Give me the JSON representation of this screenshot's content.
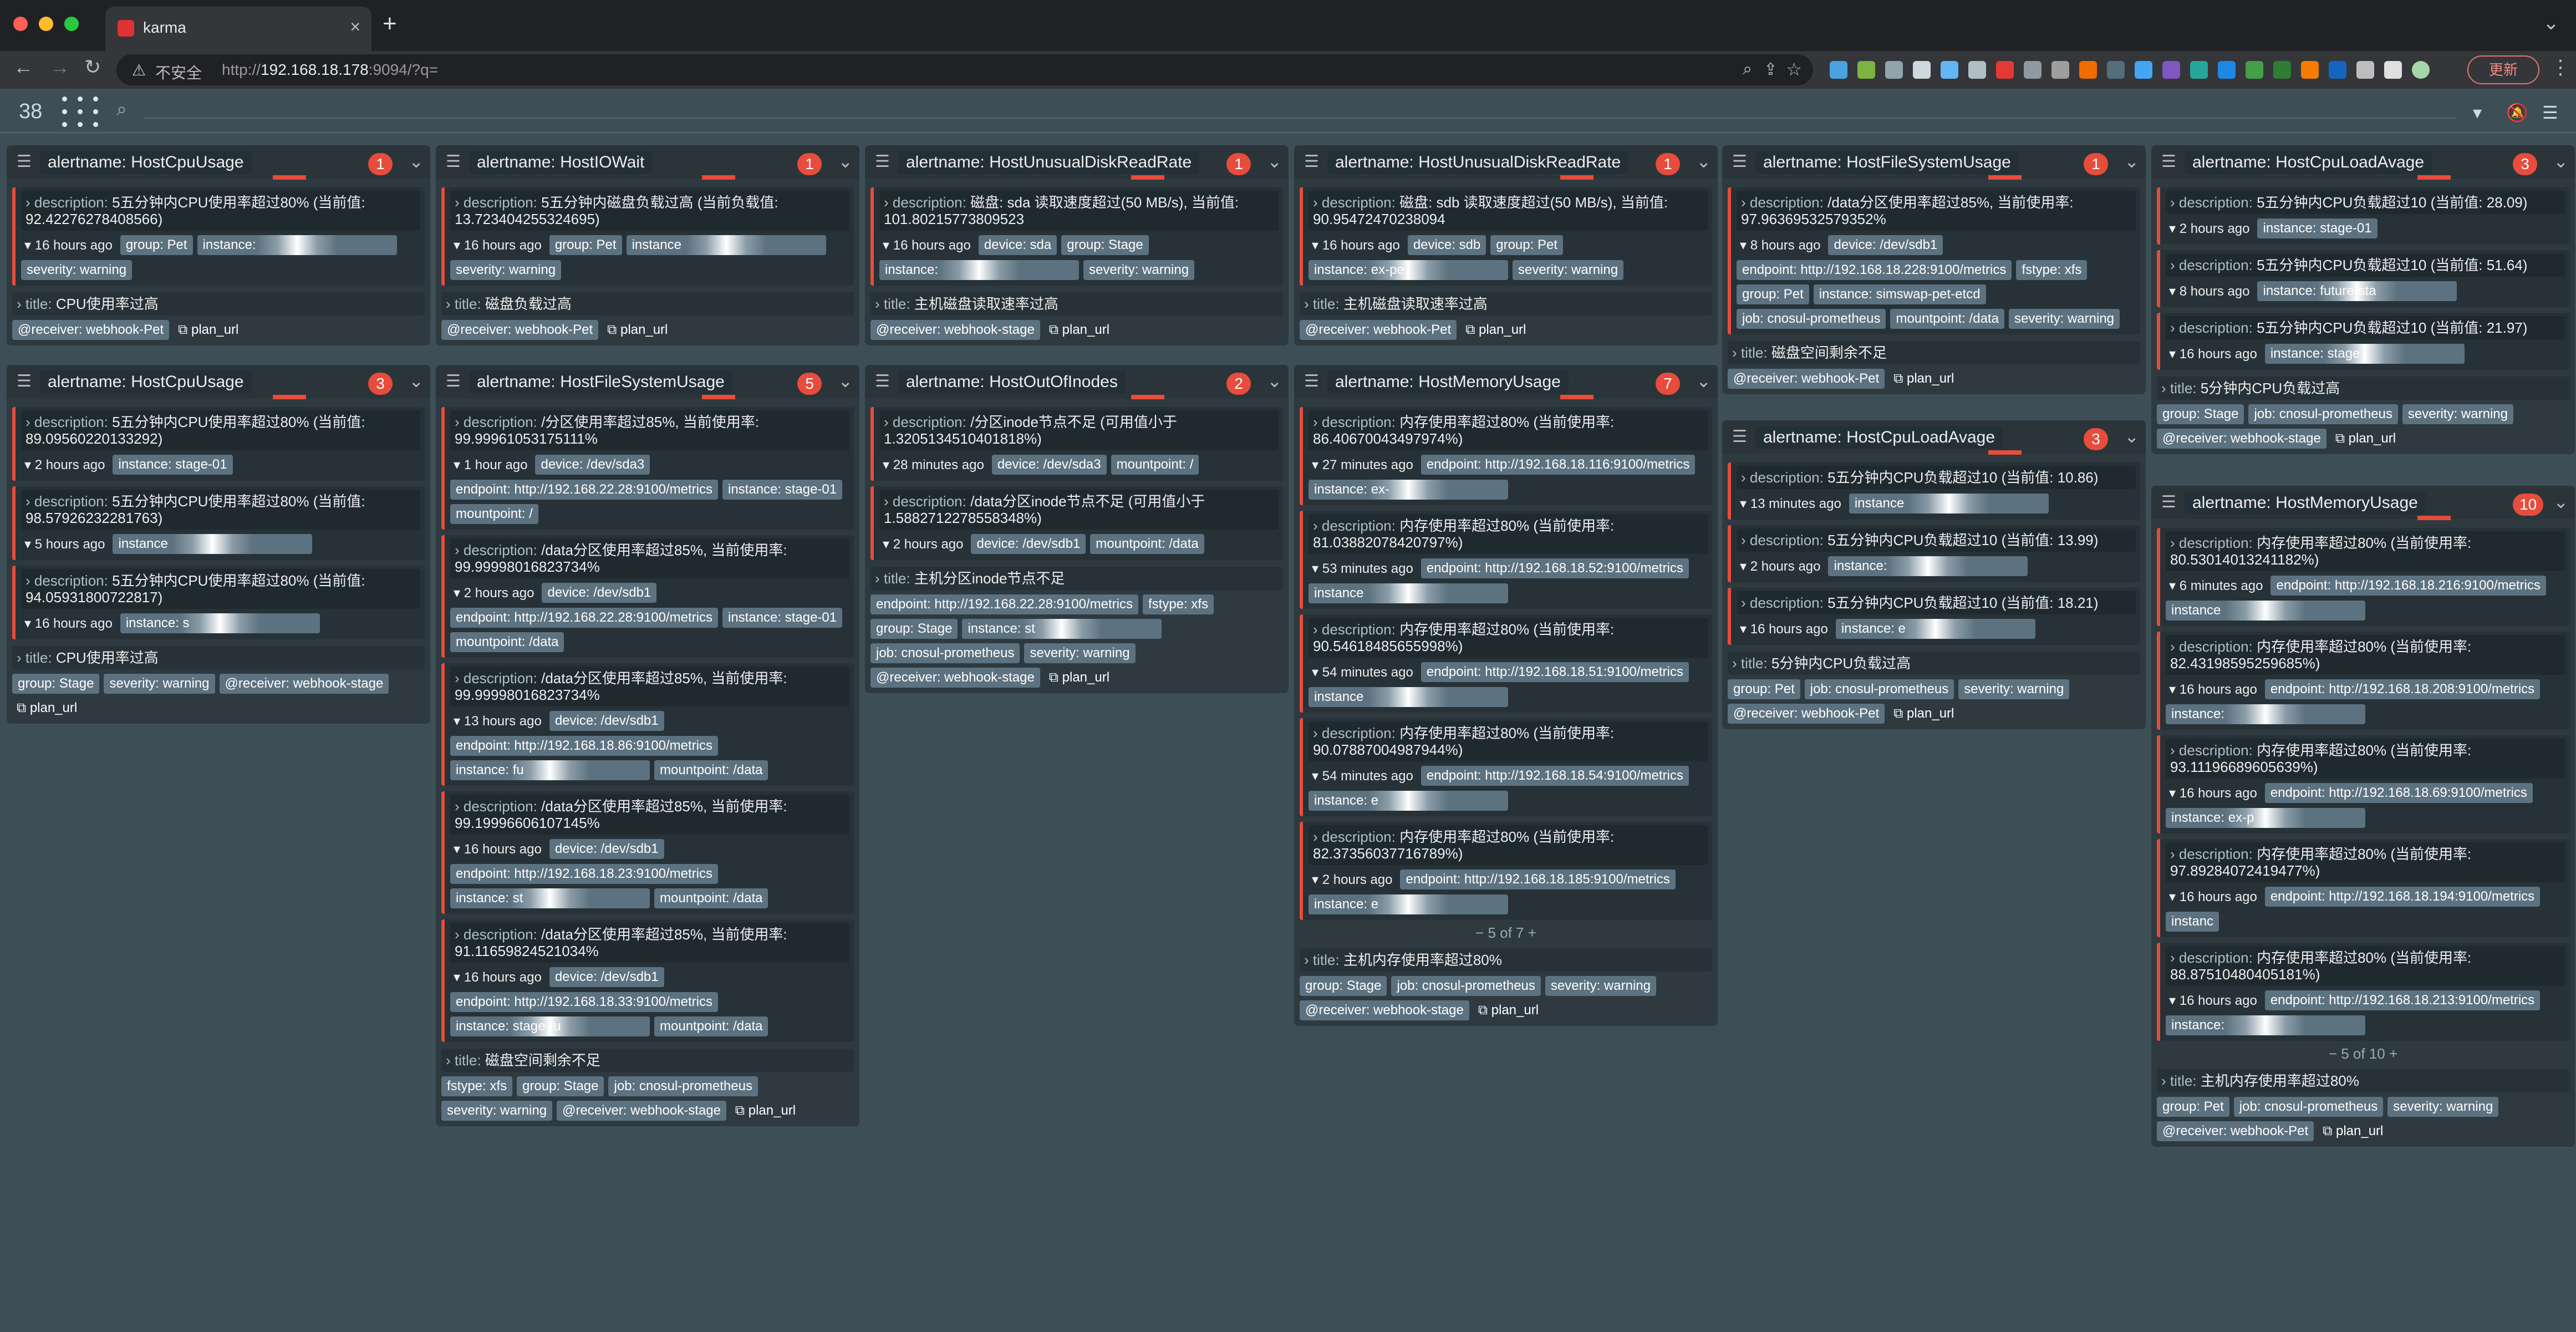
{
  "browser": {
    "tab_title": "karma",
    "url_insecure": "不安全",
    "url_host": "192.168.18.178",
    "url_rest": ":9094/?q=",
    "update_label": "更新"
  },
  "nav": {
    "count": "38"
  },
  "labels": {
    "desc": "description:",
    "title": "title:",
    "plan": "plan_url"
  },
  "groups": [
    {
      "name": "alertname: HostCpuUsage",
      "count": "1",
      "alerts": [
        {
          "desc": "5五分钟内CPU使用率超过80% (当前值: 92.42276278408566)",
          "time": "16 hours ago",
          "chips": [
            "group: Pet",
            "instance:",
            "severity: warning"
          ]
        }
      ],
      "title": "CPU使用率过高",
      "foot": [
        "@receiver: webhook-Pet"
      ]
    },
    {
      "name": "alertname: HostIOWait",
      "count": "1",
      "alerts": [
        {
          "desc": "5五分钟内磁盘负载过高 (当前负载值: 13.723404255324695)",
          "time": "16 hours ago",
          "chips": [
            "group: Pet",
            "instance",
            "severity: warning"
          ]
        }
      ],
      "title": "磁盘负载过高",
      "foot": [
        "@receiver: webhook-Pet"
      ]
    },
    {
      "name": "alertname: HostUnusualDiskReadRate",
      "count": "1",
      "alerts": [
        {
          "desc": "磁盘: sda 读取速度超过(50 MB/s), 当前值: 101.80215773809523",
          "time": "16 hours ago",
          "chips": [
            "device: sda",
            "group: Stage",
            "instance:",
            "severity: warning"
          ]
        }
      ],
      "title": "主机磁盘读取速率过高",
      "foot": [
        "@receiver: webhook-stage"
      ]
    },
    {
      "name": "alertname: HostUnusualDiskReadRate",
      "count": "1",
      "alerts": [
        {
          "desc": "磁盘: sdb 读取速度超过(50 MB/s), 当前值: 90.95472470238094",
          "time": "16 hours ago",
          "chips": [
            "device: sdb",
            "group: Pet",
            "instance: ex-pe",
            "severity: warning"
          ]
        }
      ],
      "title": "主机磁盘读取速率过高",
      "foot": [
        "@receiver: webhook-Pet"
      ]
    },
    {
      "name": "alertname: HostFileSystemUsage",
      "count": "1",
      "alerts": [
        {
          "desc": "/data分区使用率超过85%, 当前使用率: 97.96369532579352%",
          "time": "8 hours ago",
          "chips": [
            "device: /dev/sdb1",
            "endpoint: http://192.168.18.228:9100/metrics",
            "fstype: xfs",
            "group: Pet",
            "instance: simswap-pet-etcd",
            "job: cnosul-prometheus",
            "mountpoint: /data",
            "severity: warning"
          ]
        }
      ],
      "title": "磁盘空间剩余不足",
      "foot": [
        "@receiver: webhook-Pet"
      ]
    },
    {
      "name": "alertname: HostCpuLoadAvage",
      "count": "3",
      "alerts": [
        {
          "desc": "5五分钟内CPU负载超过10 (当前值: 28.09)",
          "time": "2 hours ago",
          "chips": [
            "instance: stage-01"
          ]
        },
        {
          "desc": "5五分钟内CPU负载超过10 (当前值: 51.64)",
          "time": "8 hours ago",
          "chips": [
            "instance: future-sta"
          ]
        },
        {
          "desc": "5五分钟内CPU负载超过10 (当前值: 21.97)",
          "time": "16 hours ago",
          "chips": [
            "instance: stage"
          ]
        }
      ],
      "title": "5分钟内CPU负载过高",
      "foot": [
        "group: Stage",
        "job: cnosul-prometheus",
        "severity: warning",
        "@receiver: webhook-stage"
      ]
    },
    {
      "name": "alertname: HostCpuUsage",
      "count": "3",
      "alerts": [
        {
          "desc": "5五分钟内CPU使用率超过80% (当前值: 89.09560220133292)",
          "time": "2 hours ago",
          "chips": [
            "instance: stage-01"
          ]
        },
        {
          "desc": "5五分钟内CPU使用率超过80% (当前值: 98.57926232281763)",
          "time": "5 hours ago",
          "chips": [
            "instance"
          ]
        },
        {
          "desc": "5五分钟内CPU使用率超过80% (当前值: 94.05931800722817)",
          "time": "16 hours ago",
          "chips": [
            "instance: s"
          ]
        }
      ],
      "title": "CPU使用率过高",
      "foot": [
        "group: Stage",
        "severity: warning",
        "@receiver: webhook-stage"
      ]
    },
    {
      "name": "alertname: HostFileSystemUsage",
      "count": "5",
      "alerts": [
        {
          "desc": "/分区使用率超过85%, 当前使用率: 99.99961053175111%",
          "time": "1 hour ago",
          "chips": [
            "device: /dev/sda3",
            "endpoint: http://192.168.22.28:9100/metrics",
            "instance: stage-01",
            "mountpoint: /"
          ]
        },
        {
          "desc": "/data分区使用率超过85%, 当前使用率: 99.99998016823734%",
          "time": "2 hours ago",
          "chips": [
            "device: /dev/sdb1",
            "endpoint: http://192.168.22.28:9100/metrics",
            "instance: stage-01",
            "mountpoint: /data"
          ]
        },
        {
          "desc": "/data分区使用率超过85%, 当前使用率: 99.99998016823734%",
          "time": "13 hours ago",
          "chips": [
            "device: /dev/sdb1",
            "endpoint: http://192.168.18.86:9100/metrics",
            "instance: fu",
            "mountpoint: /data"
          ]
        },
        {
          "desc": "/data分区使用率超过85%, 当前使用率: 99.19996606107145%",
          "time": "16 hours ago",
          "chips": [
            "device: /dev/sdb1",
            "endpoint: http://192.168.18.23:9100/metrics",
            "instance: st",
            "mountpoint: /data"
          ]
        },
        {
          "desc": "/data分区使用率超过85%, 当前使用率: 91.11659824521034%",
          "time": "16 hours ago",
          "chips": [
            "device: /dev/sdb1",
            "endpoint: http://192.168.18.33:9100/metrics",
            "instance: stage-fu",
            "mountpoint: /data"
          ]
        }
      ],
      "title": "磁盘空间剩余不足",
      "foot": [
        "fstype: xfs",
        "group: Stage",
        "job: cnosul-prometheus",
        "severity: warning",
        "@receiver: webhook-stage"
      ]
    },
    {
      "name": "alertname: HostOutOfInodes",
      "count": "2",
      "alerts": [
        {
          "desc": "/分区inode节点不足 (可用值小于 1.3205134510401818%)",
          "time": "28 minutes ago",
          "chips": [
            "device: /dev/sda3",
            "mountpoint: /"
          ]
        },
        {
          "desc": "/data分区inode节点不足 (可用值小于 1.5882712278558348%)",
          "time": "2 hours ago",
          "chips": [
            "device: /dev/sdb1",
            "mountpoint: /data"
          ]
        }
      ],
      "title": "主机分区inode节点不足",
      "foot": [
        "endpoint: http://192.168.22.28:9100/metrics",
        "fstype: xfs",
        "group: Stage",
        "instance: st",
        "job: cnosul-prometheus",
        "severity: warning",
        "@receiver: webhook-stage"
      ]
    },
    {
      "name": "alertname: HostMemoryUsage",
      "count": "7",
      "alerts": [
        {
          "desc": "内存使用率超过80% (当前使用率: 86.40670043497974%)",
          "time": "27 minutes ago",
          "chips": [
            "endpoint: http://192.168.18.116:9100/metrics",
            "instance: ex-"
          ]
        },
        {
          "desc": "内存使用率超过80% (当前使用率: 81.03882078420797%)",
          "time": "53 minutes ago",
          "chips": [
            "endpoint: http://192.168.18.52:9100/metrics",
            "instance"
          ]
        },
        {
          "desc": "内存使用率超过80% (当前使用率: 90.54618485655998%)",
          "time": "54 minutes ago",
          "chips": [
            "endpoint: http://192.168.18.51:9100/metrics",
            "instance"
          ]
        },
        {
          "desc": "内存使用率超过80% (当前使用率: 90.07887004987944%)",
          "time": "54 minutes ago",
          "chips": [
            "endpoint: http://192.168.18.54:9100/metrics",
            "instance: e"
          ]
        },
        {
          "desc": "内存使用率超过80% (当前使用率: 82.37356037716789%)",
          "time": "2 hours ago",
          "chips": [
            "endpoint: http://192.168.18.185:9100/metrics",
            "instance: e"
          ]
        }
      ],
      "pager": "5 of 7",
      "title": "主机内存使用率超过80%",
      "foot": [
        "group: Stage",
        "job: cnosul-prometheus",
        "severity: warning",
        "@receiver: webhook-stage"
      ]
    },
    {
      "name": "alertname: HostCpuLoadAvage",
      "count": "3",
      "alerts": [
        {
          "desc": "5五分钟内CPU负载超过10 (当前值: 10.86)",
          "time": "13 minutes ago",
          "chips": [
            "instance"
          ]
        },
        {
          "desc": "5五分钟内CPU负载超过10 (当前值: 13.99)",
          "time": "2 hours ago",
          "chips": [
            "instance:"
          ]
        },
        {
          "desc": "5五分钟内CPU负载超过10 (当前值: 18.21)",
          "time": "16 hours ago",
          "chips": [
            "instance: e"
          ]
        }
      ],
      "title": "5分钟内CPU负载过高",
      "foot": [
        "group: Pet",
        "job: cnosul-prometheus",
        "severity: warning",
        "@receiver: webhook-Pet"
      ]
    },
    {
      "name": "alertname: HostMemoryUsage",
      "count": "10",
      "alerts": [
        {
          "desc": "内存使用率超过80% (当前使用率: 80.53014013241182%)",
          "time": "6 minutes ago",
          "chips": [
            "endpoint: http://192.168.18.216:9100/metrics",
            "instance"
          ]
        },
        {
          "desc": "内存使用率超过80% (当前使用率: 82.43198595259685%)",
          "time": "16 hours ago",
          "chips": [
            "endpoint: http://192.168.18.208:9100/metrics",
            "instance:"
          ]
        },
        {
          "desc": "内存使用率超过80% (当前使用率: 93.11196689605639%)",
          "time": "16 hours ago",
          "chips": [
            "endpoint: http://192.168.18.69:9100/metrics",
            "instance: ex-p"
          ]
        },
        {
          "desc": "内存使用率超过80% (当前使用率: 97.89284072419477%)",
          "time": "16 hours ago",
          "chips": [
            "endpoint: http://192.168.18.194:9100/metrics",
            "instanc"
          ]
        },
        {
          "desc": "内存使用率超过80% (当前使用率: 88.87510480405181%)",
          "time": "16 hours ago",
          "chips": [
            "endpoint: http://192.168.18.213:9100/metrics",
            "instance: "
          ]
        }
      ],
      "pager": "5 of 10",
      "title": "主机内存使用率超过80%",
      "foot": [
        "group: Pet",
        "job: cnosul-prometheus",
        "severity: warning",
        "@receiver: webhook-Pet"
      ]
    }
  ]
}
